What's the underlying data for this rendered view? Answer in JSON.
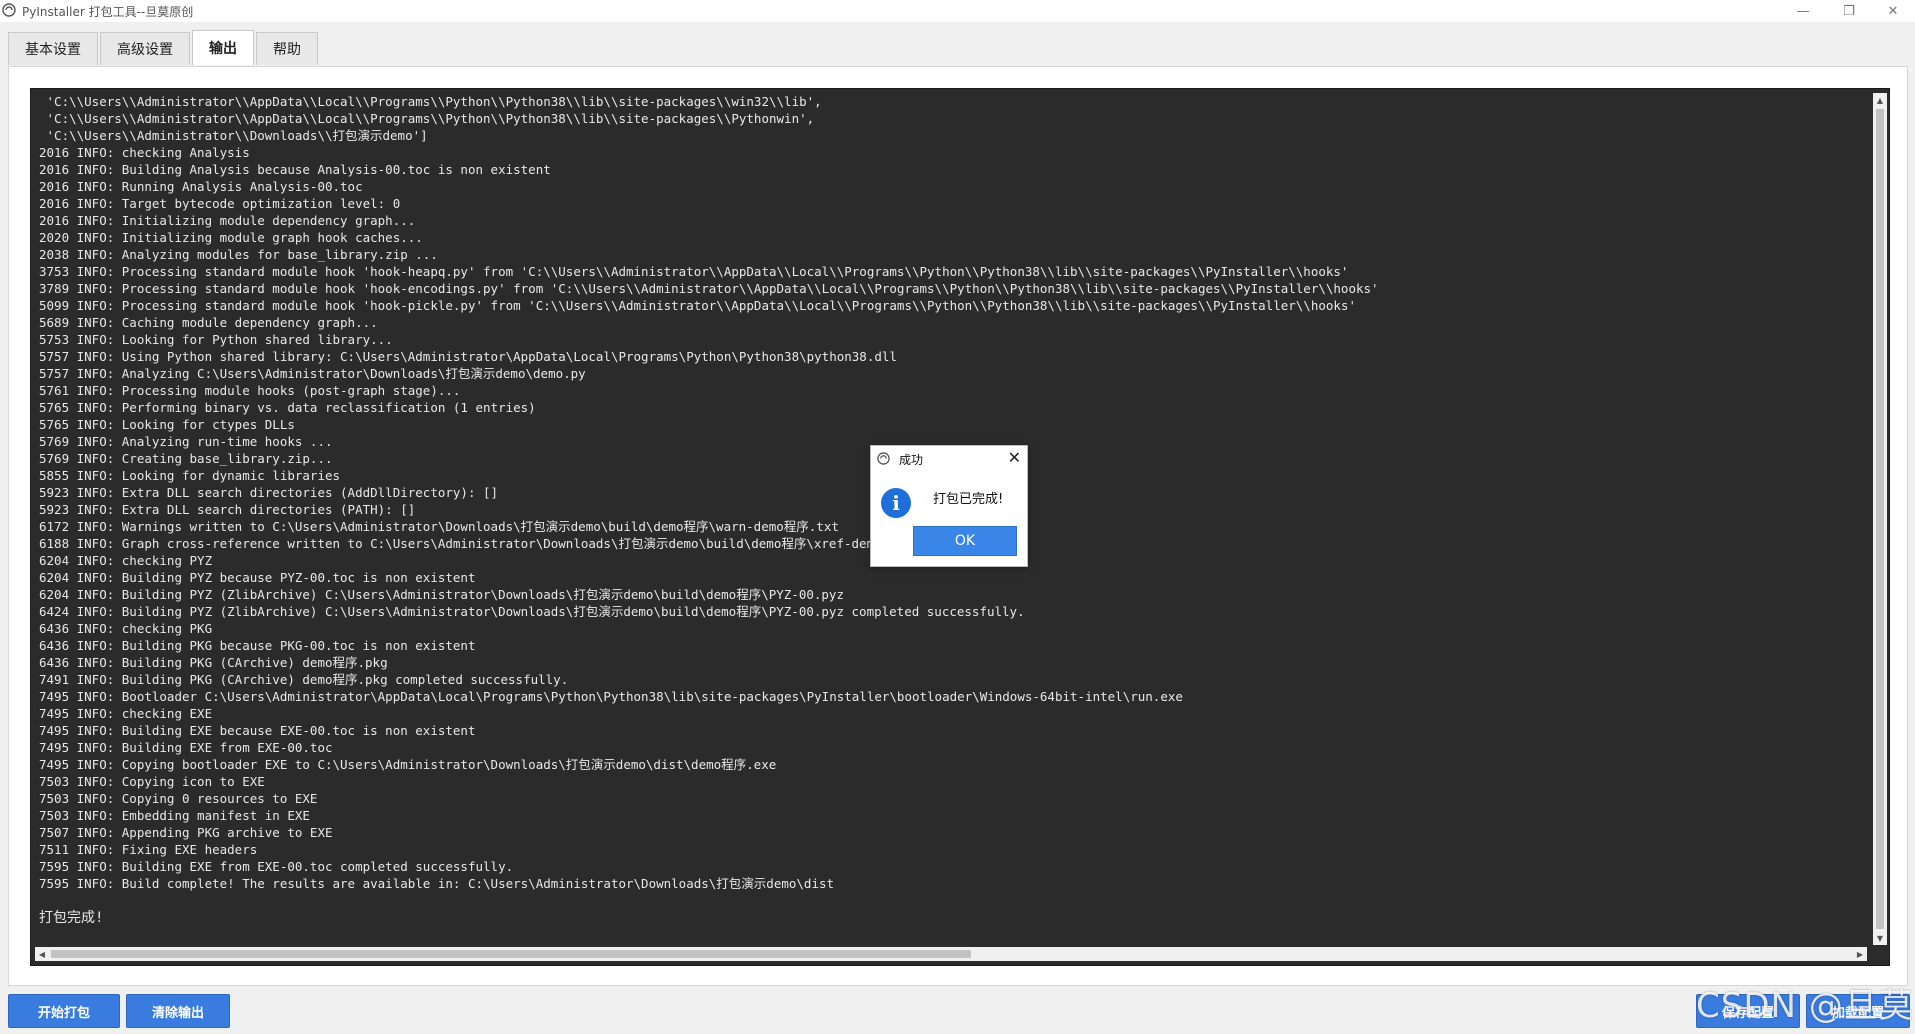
{
  "window": {
    "title": "PyInstaller 打包工具--旦莫原创",
    "minimize_glyph": "—",
    "restore_glyph": "❐",
    "close_glyph": "✕"
  },
  "tabs": [
    {
      "label": "基本设置",
      "active": false
    },
    {
      "label": "高级设置",
      "active": false
    },
    {
      "label": "输出",
      "active": true
    },
    {
      "label": "帮助",
      "active": false
    }
  ],
  "console": {
    "lines": [
      " 'C:\\\\Users\\\\Administrator\\\\AppData\\\\Local\\\\Programs\\\\Python\\\\Python38\\\\lib\\\\site-packages\\\\win32\\\\lib',",
      " 'C:\\\\Users\\\\Administrator\\\\AppData\\\\Local\\\\Programs\\\\Python\\\\Python38\\\\lib\\\\site-packages\\\\Pythonwin',",
      " 'C:\\\\Users\\\\Administrator\\\\Downloads\\\\打包演示demo']",
      "2016 INFO: checking Analysis",
      "2016 INFO: Building Analysis because Analysis-00.toc is non existent",
      "2016 INFO: Running Analysis Analysis-00.toc",
      "2016 INFO: Target bytecode optimization level: 0",
      "2016 INFO: Initializing module dependency graph...",
      "2020 INFO: Initializing module graph hook caches...",
      "2038 INFO: Analyzing modules for base_library.zip ...",
      "3753 INFO: Processing standard module hook 'hook-heapq.py' from 'C:\\\\Users\\\\Administrator\\\\AppData\\\\Local\\\\Programs\\\\Python\\\\Python38\\\\lib\\\\site-packages\\\\PyInstaller\\\\hooks'",
      "3789 INFO: Processing standard module hook 'hook-encodings.py' from 'C:\\\\Users\\\\Administrator\\\\AppData\\\\Local\\\\Programs\\\\Python\\\\Python38\\\\lib\\\\site-packages\\\\PyInstaller\\\\hooks'",
      "5099 INFO: Processing standard module hook 'hook-pickle.py' from 'C:\\\\Users\\\\Administrator\\\\AppData\\\\Local\\\\Programs\\\\Python\\\\Python38\\\\lib\\\\site-packages\\\\PyInstaller\\\\hooks'",
      "5689 INFO: Caching module dependency graph...",
      "5753 INFO: Looking for Python shared library...",
      "5757 INFO: Using Python shared library: C:\\Users\\Administrator\\AppData\\Local\\Programs\\Python\\Python38\\python38.dll",
      "5757 INFO: Analyzing C:\\Users\\Administrator\\Downloads\\打包演示demo\\demo.py",
      "5761 INFO: Processing module hooks (post-graph stage)...",
      "5765 INFO: Performing binary vs. data reclassification (1 entries)",
      "5765 INFO: Looking for ctypes DLLs",
      "5769 INFO: Analyzing run-time hooks ...",
      "5769 INFO: Creating base_library.zip...",
      "5855 INFO: Looking for dynamic libraries",
      "5923 INFO: Extra DLL search directories (AddDllDirectory): []",
      "5923 INFO: Extra DLL search directories (PATH): []",
      "6172 INFO: Warnings written to C:\\Users\\Administrator\\Downloads\\打包演示demo\\build\\demo程序\\warn-demo程序.txt",
      "6188 INFO: Graph cross-reference written to C:\\Users\\Administrator\\Downloads\\打包演示demo\\build\\demo程序\\xref-demo程序.html",
      "6204 INFO: checking PYZ",
      "6204 INFO: Building PYZ because PYZ-00.toc is non existent",
      "6204 INFO: Building PYZ (ZlibArchive) C:\\Users\\Administrator\\Downloads\\打包演示demo\\build\\demo程序\\PYZ-00.pyz",
      "6424 INFO: Building PYZ (ZlibArchive) C:\\Users\\Administrator\\Downloads\\打包演示demo\\build\\demo程序\\PYZ-00.pyz completed successfully.",
      "6436 INFO: checking PKG",
      "6436 INFO: Building PKG because PKG-00.toc is non existent",
      "6436 INFO: Building PKG (CArchive) demo程序.pkg",
      "7491 INFO: Building PKG (CArchive) demo程序.pkg completed successfully.",
      "7495 INFO: Bootloader C:\\Users\\Administrator\\AppData\\Local\\Programs\\Python\\Python38\\lib\\site-packages\\PyInstaller\\bootloader\\Windows-64bit-intel\\run.exe",
      "7495 INFO: checking EXE",
      "7495 INFO: Building EXE because EXE-00.toc is non existent",
      "7495 INFO: Building EXE from EXE-00.toc",
      "7495 INFO: Copying bootloader EXE to C:\\Users\\Administrator\\Downloads\\打包演示demo\\dist\\demo程序.exe",
      "7503 INFO: Copying icon to EXE",
      "7503 INFO: Copying 0 resources to EXE",
      "7503 INFO: Embedding manifest in EXE",
      "7507 INFO: Appending PKG archive to EXE",
      "7511 INFO: Fixing EXE headers",
      "7595 INFO: Building EXE from EXE-00.toc completed successfully.",
      "7595 INFO: Build complete! The results are available in: C:\\Users\\Administrator\\Downloads\\打包演示demo\\dist"
    ],
    "final_line": "打包完成!"
  },
  "buttons": {
    "start": "开始打包",
    "clear": "清除输出",
    "save": "保存配置",
    "load": "加载配置"
  },
  "watermark": "CSDN @旦莫",
  "dialog": {
    "title": "成功",
    "message": "打包已完成!",
    "ok_label": "OK",
    "close_glyph": "✕",
    "info_glyph": "i"
  },
  "colors": {
    "accent": "#3a7be0",
    "console_bg": "#2b2b2b",
    "info_blue": "#1e6fd9"
  }
}
